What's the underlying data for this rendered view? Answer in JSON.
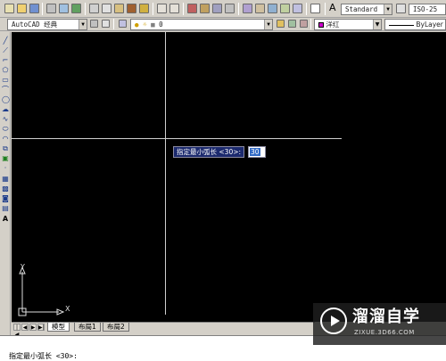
{
  "toolbar_top": {
    "text_style": "Standard",
    "dim_style": "ISO-25"
  },
  "toolbar_second": {
    "workspace": "AutoCAD 经典",
    "layer": "0",
    "color": "洋红",
    "linetype": "ByLayer"
  },
  "dynamic_input": {
    "prompt": "指定最小弧长 <30>:",
    "value": "30"
  },
  "ucs": {
    "x_label": "X",
    "y_label": "Y"
  },
  "tabs": [
    {
      "label": "模型",
      "active": true
    },
    {
      "label": "布局1",
      "active": false
    },
    {
      "label": "布局2",
      "active": false
    }
  ],
  "command": {
    "line": "指定最小弧长 <30>:"
  },
  "watermark": {
    "title": "溜溜自学",
    "url": "ZIXUE.3D66.COM"
  },
  "colors": {
    "canvas": "#000000",
    "crosshair": "#cfcfcf",
    "prompt_bg": "#1c2a6e",
    "magenta": "#cc00cc",
    "chrome": "#d4d0c8"
  }
}
